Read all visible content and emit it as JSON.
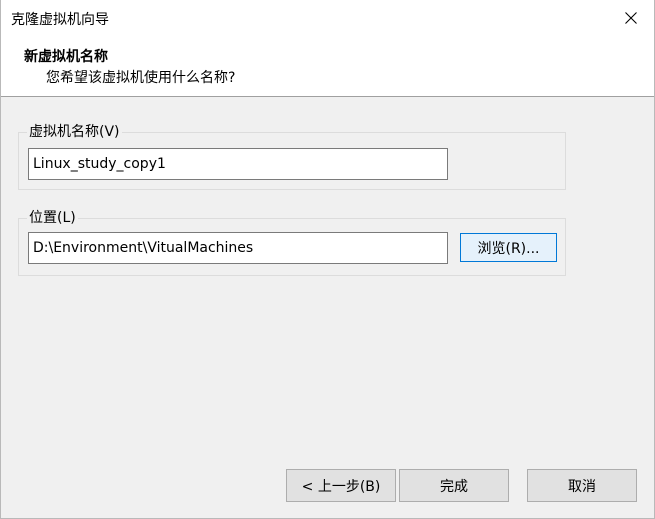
{
  "window": {
    "title": "克隆虚拟机向导",
    "close_icon": "close-icon"
  },
  "header": {
    "title": "新虚拟机名称",
    "subtitle": "您希望该虚拟机使用什么名称?"
  },
  "vm_name_group": {
    "label": "虚拟机名称(V)",
    "value": "Linux_study_copy1"
  },
  "location_group": {
    "label": "位置(L)",
    "value": "D:\\Environment\\VitualMachines",
    "browse_label": "浏览(R)..."
  },
  "footer": {
    "back_label": "< 上一步(B)",
    "finish_label": "完成",
    "cancel_label": "取消"
  },
  "colors": {
    "dialog_bg": "#f0f0f0",
    "header_bg": "#ffffff",
    "focus_border": "#0078d7"
  }
}
